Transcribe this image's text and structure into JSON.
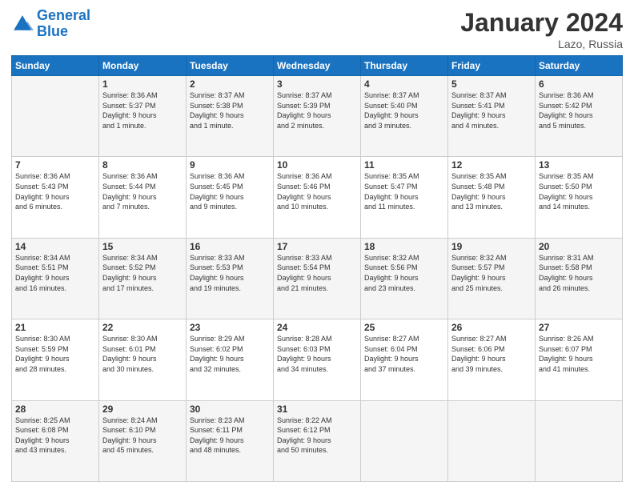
{
  "header": {
    "logo_line1": "General",
    "logo_line2": "Blue",
    "month_title": "January 2024",
    "location": "Lazo, Russia"
  },
  "weekdays": [
    "Sunday",
    "Monday",
    "Tuesday",
    "Wednesday",
    "Thursday",
    "Friday",
    "Saturday"
  ],
  "weeks": [
    [
      {
        "day": "",
        "info": ""
      },
      {
        "day": "1",
        "info": "Sunrise: 8:36 AM\nSunset: 5:37 PM\nDaylight: 9 hours\nand 1 minute."
      },
      {
        "day": "2",
        "info": "Sunrise: 8:37 AM\nSunset: 5:38 PM\nDaylight: 9 hours\nand 1 minute."
      },
      {
        "day": "3",
        "info": "Sunrise: 8:37 AM\nSunset: 5:39 PM\nDaylight: 9 hours\nand 2 minutes."
      },
      {
        "day": "4",
        "info": "Sunrise: 8:37 AM\nSunset: 5:40 PM\nDaylight: 9 hours\nand 3 minutes."
      },
      {
        "day": "5",
        "info": "Sunrise: 8:37 AM\nSunset: 5:41 PM\nDaylight: 9 hours\nand 4 minutes."
      },
      {
        "day": "6",
        "info": "Sunrise: 8:36 AM\nSunset: 5:42 PM\nDaylight: 9 hours\nand 5 minutes."
      }
    ],
    [
      {
        "day": "7",
        "info": "Sunrise: 8:36 AM\nSunset: 5:43 PM\nDaylight: 9 hours\nand 6 minutes."
      },
      {
        "day": "8",
        "info": "Sunrise: 8:36 AM\nSunset: 5:44 PM\nDaylight: 9 hours\nand 7 minutes."
      },
      {
        "day": "9",
        "info": "Sunrise: 8:36 AM\nSunset: 5:45 PM\nDaylight: 9 hours\nand 9 minutes."
      },
      {
        "day": "10",
        "info": "Sunrise: 8:36 AM\nSunset: 5:46 PM\nDaylight: 9 hours\nand 10 minutes."
      },
      {
        "day": "11",
        "info": "Sunrise: 8:35 AM\nSunset: 5:47 PM\nDaylight: 9 hours\nand 11 minutes."
      },
      {
        "day": "12",
        "info": "Sunrise: 8:35 AM\nSunset: 5:48 PM\nDaylight: 9 hours\nand 13 minutes."
      },
      {
        "day": "13",
        "info": "Sunrise: 8:35 AM\nSunset: 5:50 PM\nDaylight: 9 hours\nand 14 minutes."
      }
    ],
    [
      {
        "day": "14",
        "info": "Sunrise: 8:34 AM\nSunset: 5:51 PM\nDaylight: 9 hours\nand 16 minutes."
      },
      {
        "day": "15",
        "info": "Sunrise: 8:34 AM\nSunset: 5:52 PM\nDaylight: 9 hours\nand 17 minutes."
      },
      {
        "day": "16",
        "info": "Sunrise: 8:33 AM\nSunset: 5:53 PM\nDaylight: 9 hours\nand 19 minutes."
      },
      {
        "day": "17",
        "info": "Sunrise: 8:33 AM\nSunset: 5:54 PM\nDaylight: 9 hours\nand 21 minutes."
      },
      {
        "day": "18",
        "info": "Sunrise: 8:32 AM\nSunset: 5:56 PM\nDaylight: 9 hours\nand 23 minutes."
      },
      {
        "day": "19",
        "info": "Sunrise: 8:32 AM\nSunset: 5:57 PM\nDaylight: 9 hours\nand 25 minutes."
      },
      {
        "day": "20",
        "info": "Sunrise: 8:31 AM\nSunset: 5:58 PM\nDaylight: 9 hours\nand 26 minutes."
      }
    ],
    [
      {
        "day": "21",
        "info": "Sunrise: 8:30 AM\nSunset: 5:59 PM\nDaylight: 9 hours\nand 28 minutes."
      },
      {
        "day": "22",
        "info": "Sunrise: 8:30 AM\nSunset: 6:01 PM\nDaylight: 9 hours\nand 30 minutes."
      },
      {
        "day": "23",
        "info": "Sunrise: 8:29 AM\nSunset: 6:02 PM\nDaylight: 9 hours\nand 32 minutes."
      },
      {
        "day": "24",
        "info": "Sunrise: 8:28 AM\nSunset: 6:03 PM\nDaylight: 9 hours\nand 34 minutes."
      },
      {
        "day": "25",
        "info": "Sunrise: 8:27 AM\nSunset: 6:04 PM\nDaylight: 9 hours\nand 37 minutes."
      },
      {
        "day": "26",
        "info": "Sunrise: 8:27 AM\nSunset: 6:06 PM\nDaylight: 9 hours\nand 39 minutes."
      },
      {
        "day": "27",
        "info": "Sunrise: 8:26 AM\nSunset: 6:07 PM\nDaylight: 9 hours\nand 41 minutes."
      }
    ],
    [
      {
        "day": "28",
        "info": "Sunrise: 8:25 AM\nSunset: 6:08 PM\nDaylight: 9 hours\nand 43 minutes."
      },
      {
        "day": "29",
        "info": "Sunrise: 8:24 AM\nSunset: 6:10 PM\nDaylight: 9 hours\nand 45 minutes."
      },
      {
        "day": "30",
        "info": "Sunrise: 8:23 AM\nSunset: 6:11 PM\nDaylight: 9 hours\nand 48 minutes."
      },
      {
        "day": "31",
        "info": "Sunrise: 8:22 AM\nSunset: 6:12 PM\nDaylight: 9 hours\nand 50 minutes."
      },
      {
        "day": "",
        "info": ""
      },
      {
        "day": "",
        "info": ""
      },
      {
        "day": "",
        "info": ""
      }
    ]
  ]
}
